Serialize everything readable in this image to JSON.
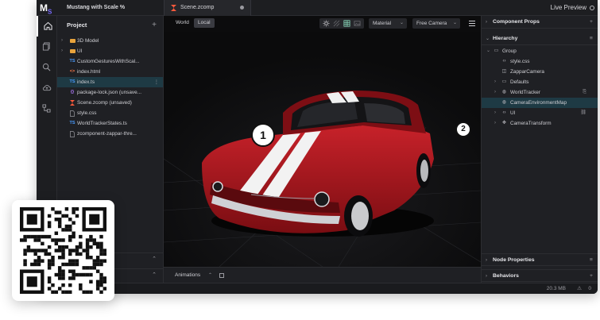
{
  "app": {
    "logo": "M",
    "logo_sub": "S",
    "project_title": "Mustang with Scale %",
    "tab_label": "Scene.zcomp",
    "live_preview": "Live Preview"
  },
  "project_panel": {
    "title": "Project",
    "add": "+",
    "items": [
      {
        "chev": "›",
        "icon": "folder",
        "label": "3D Model",
        "selected": false
      },
      {
        "chev": "›",
        "icon": "folder",
        "label": "UI",
        "selected": false
      },
      {
        "chev": "",
        "icon": "TS",
        "label": "CustomGesturesWithScal...",
        "selected": false
      },
      {
        "chev": "",
        "icon": "<>",
        "label": "index.html",
        "selected": false
      },
      {
        "chev": "",
        "icon": "TS",
        "label": "index.ts",
        "selected": true
      },
      {
        "chev": "",
        "icon": "{}",
        "label": "package-lock.json (unsave...",
        "selected": false
      },
      {
        "chev": "",
        "icon": "Z",
        "label": "Scene.zcomp (unsaved)",
        "selected": false
      },
      {
        "chev": "",
        "icon": "doc",
        "label": "style.css",
        "selected": false
      },
      {
        "chev": "",
        "icon": "TS",
        "label": "WorldTrackerStates.ts",
        "selected": false
      },
      {
        "chev": "",
        "icon": "doc",
        "label": "zcomponent-zappar-thre...",
        "selected": false
      }
    ],
    "more": "⋮"
  },
  "viewport": {
    "world": "World",
    "local": "Local",
    "material": "Material",
    "camera": "Free Camera",
    "markers": [
      "1",
      "2"
    ]
  },
  "animations": {
    "label": "Animations"
  },
  "right_panel": {
    "component_props": "Component Props",
    "hierarchy": "Hierarchy",
    "node_properties": "Node Properties",
    "behaviors": "Behaviors",
    "add": "+",
    "menu": "≡",
    "tree": [
      {
        "depth": 0,
        "chev": "⌄",
        "icon": "folder",
        "label": "Group",
        "selected": false,
        "tag": ""
      },
      {
        "depth": 1,
        "chev": "",
        "icon": "code",
        "label": "style.css",
        "selected": false,
        "tag": ""
      },
      {
        "depth": 1,
        "chev": "",
        "icon": "camera",
        "label": "ZapparCamera",
        "selected": false,
        "tag": ""
      },
      {
        "depth": 1,
        "chev": "›",
        "icon": "folder",
        "label": "Defaults",
        "selected": false,
        "tag": ""
      },
      {
        "depth": 1,
        "chev": "›",
        "icon": "globe",
        "label": "WorldTracker",
        "selected": false,
        "tag": "attach"
      },
      {
        "depth": 1,
        "chev": "",
        "icon": "globe",
        "label": "CameraEnvironmentMap",
        "selected": true,
        "tag": ""
      },
      {
        "depth": 1,
        "chev": "›",
        "icon": "code",
        "label": "UI",
        "selected": false,
        "tag": "link"
      },
      {
        "depth": 1,
        "chev": "›",
        "icon": "move",
        "label": "CameraTransform",
        "selected": false,
        "tag": ""
      }
    ]
  },
  "status": {
    "size": "20.3 MB",
    "warnings": "0"
  },
  "colors": {
    "accent": "#1e3a44",
    "car": "#b3141a",
    "tab_icon": "#ff5a3c"
  }
}
